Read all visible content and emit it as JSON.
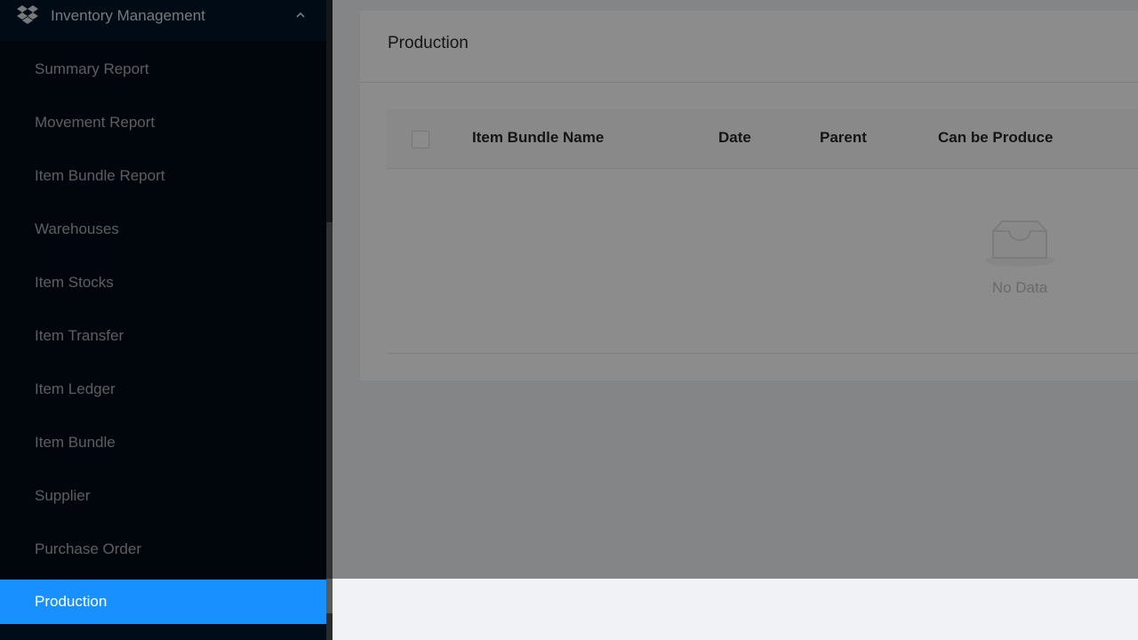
{
  "sidebar": {
    "submenu_title": "Inventory Management",
    "logo_icon": "dropbox-icon",
    "chevron_icon": "chevron-up-icon",
    "items": [
      {
        "label": "Summary Report"
      },
      {
        "label": "Movement Report"
      },
      {
        "label": "Item Bundle Report"
      },
      {
        "label": "Warehouses"
      },
      {
        "label": "Item Stocks"
      },
      {
        "label": "Item Transfer"
      },
      {
        "label": "Item Ledger"
      },
      {
        "label": "Item Bundle"
      },
      {
        "label": "Supplier"
      },
      {
        "label": "Purchase Order"
      },
      {
        "label": "Production",
        "selected": true
      }
    ],
    "selected_color": "#1890ff"
  },
  "page": {
    "title": "Production"
  },
  "table": {
    "columns": [
      "Item Bundle Name",
      "Date",
      "Parent",
      "Can be Produce"
    ],
    "rows": [],
    "empty_text": "No Data"
  }
}
